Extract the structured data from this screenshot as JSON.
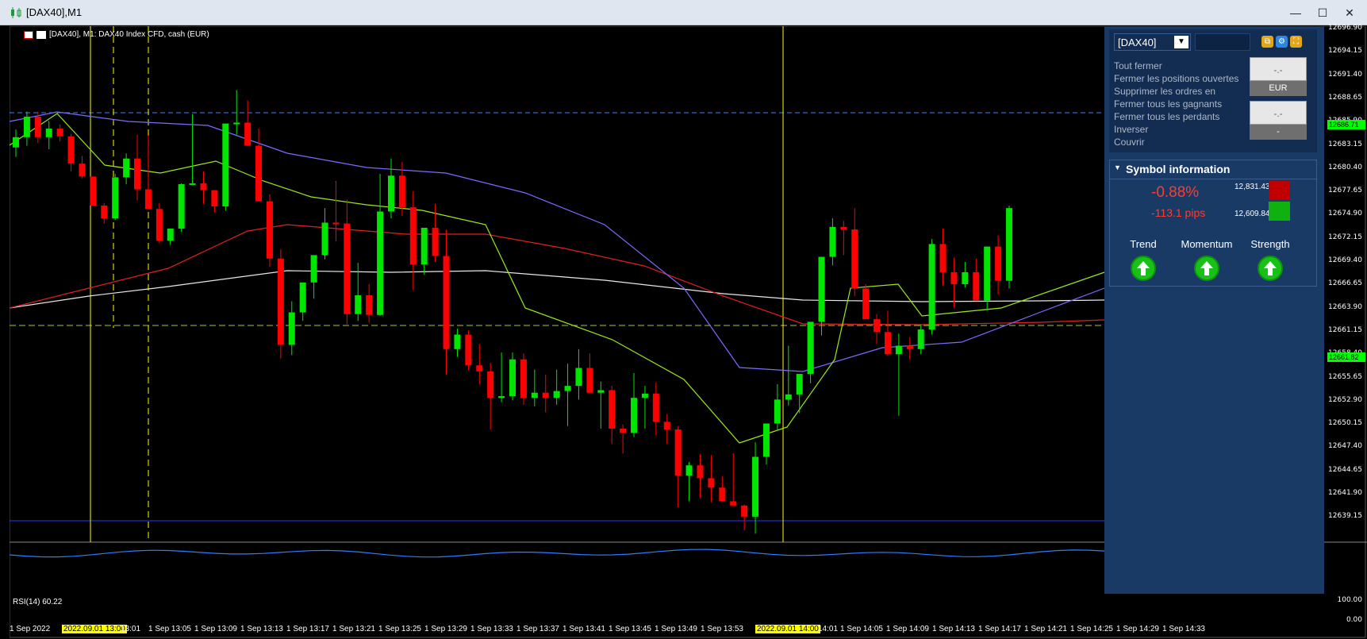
{
  "window": {
    "title": "[DAX40],M1",
    "minimize": "—",
    "maximize": "☐",
    "close": "✕"
  },
  "chart": {
    "label": "[DAX40], M1:  DAX40 Index CFD, cash (EUR)",
    "rsi_label": "RSI(14) 60.22",
    "price_labels": [
      "12696.90",
      "12694.15",
      "12691.40",
      "12688.65",
      "12685.90",
      "12683.15",
      "12680.40",
      "12677.65",
      "12674.90",
      "12672.15",
      "12669.40",
      "12666.65",
      "12663.90",
      "12661.15",
      "12658.40",
      "12655.65",
      "12652.90",
      "12650.15",
      "12647.40",
      "12644.65",
      "12641.90",
      "12639.15"
    ],
    "price_tag_top": "12686.71",
    "price_tag_mid": "12661.82",
    "rsi_levels": [
      "100.00",
      "0.00"
    ],
    "time_labels": [
      "1 Sep 2022",
      "2022.09.01 13:00",
      "13:01",
      "1 Sep 13:05",
      "1 Sep 13:09",
      "1 Sep 13:13",
      "1 Sep 13:17",
      "1 Sep 13:21",
      "1 Sep 13:25",
      "1 Sep 13:29",
      "1 Sep 13:33",
      "1 Sep 13:37",
      "1 Sep 13:41",
      "1 Sep 13:45",
      "1 Sep 13:49",
      "1 Sep 13:53",
      "2022.09.01 14:00",
      "14:01",
      "1 Sep 14:05",
      "1 Sep 14:09",
      "1 Sep 14:13",
      "1 Sep 14:17",
      "1 Sep 14:21",
      "1 Sep 14:25",
      "1 Sep 14:29",
      "1 Sep 14:33"
    ],
    "candles": [
      [
        12683.4,
        12685.5,
        12682.3,
        12684.6
      ],
      [
        12684.6,
        12687.6,
        12683.6,
        12687.0
      ],
      [
        12687.0,
        12687.6,
        12683.9,
        12684.6
      ],
      [
        12684.6,
        12686.5,
        12683.2,
        12685.6
      ],
      [
        12685.6,
        12686.1,
        12684.1,
        12684.7
      ],
      [
        12684.7,
        12685.0,
        12680.6,
        12681.5
      ],
      [
        12681.5,
        12682.4,
        12679.8,
        12680.0
      ],
      [
        12680.0,
        12679.8,
        12676.9,
        12676.6
      ],
      [
        12676.6,
        12676.9,
        12674.5,
        12675.1
      ],
      [
        12675.1,
        12680.3,
        12674.9,
        12679.9
      ],
      [
        12679.9,
        12682.7,
        12679.1,
        12682.1
      ],
      [
        12682.1,
        12684.9,
        12677.2,
        12678.5
      ],
      [
        12678.5,
        12684.8,
        12676.4,
        12676.2
      ],
      [
        12676.2,
        12676.9,
        12672.2,
        12672.5
      ],
      [
        12672.5,
        12673.9,
        12672.0,
        12673.9
      ],
      [
        12673.9,
        12679.2,
        12673.5,
        12679.1
      ],
      [
        12679.1,
        12687.3,
        12679.1,
        12679.2
      ],
      [
        12679.2,
        12680.6,
        12676.8,
        12678.4
      ],
      [
        12678.4,
        12678.4,
        12675.8,
        12676.5
      ],
      [
        12676.5,
        12683.2,
        12676.0,
        12686.2
      ],
      [
        12686.2,
        12690.1,
        12684.9,
        12686.3
      ],
      [
        12686.3,
        12688.9,
        12685.2,
        12683.6
      ],
      [
        12683.6,
        12685.6,
        12682.2,
        12677.1
      ],
      [
        12677.1,
        12677.9,
        12669.4,
        12670.4
      ],
      [
        12670.4,
        12671.5,
        12658.7,
        12660.3
      ],
      [
        12660.3,
        12665.4,
        12659.1,
        12664.1
      ],
      [
        12664.1,
        12667.5,
        12663.1,
        12667.6
      ],
      [
        12667.6,
        12670.5,
        12665.7,
        12670.8
      ],
      [
        12670.8,
        12676.3,
        12670.3,
        12674.6
      ],
      [
        12674.6,
        12679.5,
        12672.4,
        12674.5
      ],
      [
        12674.5,
        12677.3,
        12662.7,
        12663.9
      ],
      [
        12663.9,
        12669.9,
        12663.1,
        12666.1
      ],
      [
        12666.1,
        12667.4,
        12662.9,
        12663.8
      ],
      [
        12663.8,
        12680.3,
        12663.7,
        12675.9
      ],
      [
        12675.9,
        12682.1,
        12675.1,
        12680.1
      ],
      [
        12680.1,
        12681.7,
        12675.4,
        12676.4
      ],
      [
        12676.4,
        12678.3,
        12666.7,
        12669.7
      ],
      [
        12669.7,
        12673.6,
        12668.5,
        12674.0
      ],
      [
        12674.0,
        12676.8,
        12670.0,
        12670.7
      ],
      [
        12670.7,
        12673.8,
        12656.8,
        12659.8
      ],
      [
        12659.8,
        12662.2,
        12658.9,
        12661.5
      ],
      [
        12661.5,
        12662.0,
        12657.3,
        12657.9
      ],
      [
        12657.9,
        12660.4,
        12655.7,
        12657.2
      ],
      [
        12657.2,
        12658.2,
        12650.4,
        12654.1
      ],
      [
        12654.1,
        12659.4,
        12653.6,
        12654.3
      ],
      [
        12654.3,
        12659.4,
        12653.8,
        12658.6
      ],
      [
        12658.6,
        12659.3,
        12653.3,
        12654.1
      ],
      [
        12654.1,
        12657.4,
        12653.1,
        12654.7
      ],
      [
        12654.7,
        12656.8,
        12652.4,
        12654.1
      ],
      [
        12654.1,
        12657.4,
        12653.3,
        12654.9
      ],
      [
        12654.9,
        12658.1,
        12650.8,
        12655.5
      ],
      [
        12655.5,
        12659.8,
        12653.9,
        12657.6
      ],
      [
        12657.6,
        12659.3,
        12654.7,
        12654.7
      ],
      [
        12654.7,
        12656.0,
        12650.5,
        12655.0
      ],
      [
        12655.0,
        12655.5,
        12648.7,
        12650.5
      ],
      [
        12650.5,
        12651.0,
        12647.6,
        12650.0
      ],
      [
        12650.0,
        12657.0,
        12649.5,
        12654.1
      ],
      [
        12654.1,
        12655.5,
        12650.5,
        12654.6
      ],
      [
        12654.6,
        12655.9,
        12649.7,
        12651.3
      ],
      [
        12651.3,
        12652.2,
        12648.7,
        12650.4
      ],
      [
        12650.4,
        12650.8,
        12641.3,
        12645.0
      ],
      [
        12645.0,
        12646.6,
        12642.0,
        12646.2
      ],
      [
        12646.2,
        12647.5,
        12642.4,
        12644.7
      ],
      [
        12644.7,
        12647.4,
        12641.9,
        12643.6
      ],
      [
        12643.6,
        12644.9,
        12641.9,
        12642.0
      ],
      [
        12642.0,
        12647.6,
        12641.6,
        12641.5
      ],
      [
        12641.5,
        12641.6,
        12638.6,
        12640.2
      ],
      [
        12640.2,
        12648.9,
        12638.2,
        12647.2
      ],
      [
        12647.2,
        12650.2,
        12646.3,
        12651.1
      ],
      [
        12651.1,
        12655.7,
        12650.3,
        12653.9
      ],
      [
        12653.9,
        12660.2,
        12653.2,
        12654.5
      ],
      [
        12654.5,
        12656.3,
        12652.3,
        12656.9
      ],
      [
        12656.9,
        12662.9,
        12655.8,
        12663.0
      ],
      [
        12663.0,
        12669.3,
        12661.4,
        12670.6
      ],
      [
        12670.6,
        12675.1,
        12669.6,
        12674.1
      ],
      [
        12674.1,
        12674.8,
        12670.8,
        12673.8
      ],
      [
        12673.8,
        12676.3,
        12666.0,
        12666.9
      ],
      [
        12666.9,
        12667.4,
        12663.4,
        12663.3
      ],
      [
        12663.3,
        12663.9,
        12660.4,
        12661.8
      ],
      [
        12661.8,
        12664.3,
        12659.0,
        12659.2
      ],
      [
        12659.2,
        12661.6,
        12652.0,
        12660.2
      ],
      [
        12660.2,
        12661.2,
        12658.6,
        12659.8
      ],
      [
        12659.8,
        12662.7,
        12659.2,
        12662.1
      ],
      [
        12662.1,
        12672.7,
        12661.5,
        12672.1
      ],
      [
        12672.1,
        12673.9,
        12667.2,
        12668.8
      ],
      [
        12668.8,
        12670.5,
        12664.7,
        12667.4
      ],
      [
        12667.4,
        12670.0,
        12667.0,
        12668.8
      ],
      [
        12668.8,
        12670.4,
        12665.8,
        12665.5
      ],
      [
        12665.5,
        12670.9,
        12664.3,
        12671.8
      ],
      [
        12671.8,
        12673.1,
        12666.2,
        12667.8
      ],
      [
        12667.8,
        12676.6,
        12666.9,
        12676.3
      ]
    ]
  },
  "panel": {
    "symbol": "[DAX40]",
    "actions": [
      "Tout fermer",
      "Fermer les positions ouvertes",
      "Supprimer les ordres en",
      "Fermer tous les gagnants",
      "Fermer tous les perdants",
      "Inverser",
      "Couvrir"
    ],
    "box1_value": "-.-",
    "box1_currency": "EUR",
    "box2_value": "-.-",
    "box2_currency": "-",
    "symbol_info_title": "Symbol information",
    "change_pct": "-0.88%",
    "change_pips": "-113.1 pips",
    "high": "12,831.43",
    "low": "12,609.84",
    "indicators": [
      "Trend",
      "Momentum",
      "Strength"
    ]
  },
  "colors": {
    "bull": "#00e600",
    "bear": "#ff0000",
    "panel_bg": "#1a3a66",
    "yellow_line": "#ffff00"
  }
}
